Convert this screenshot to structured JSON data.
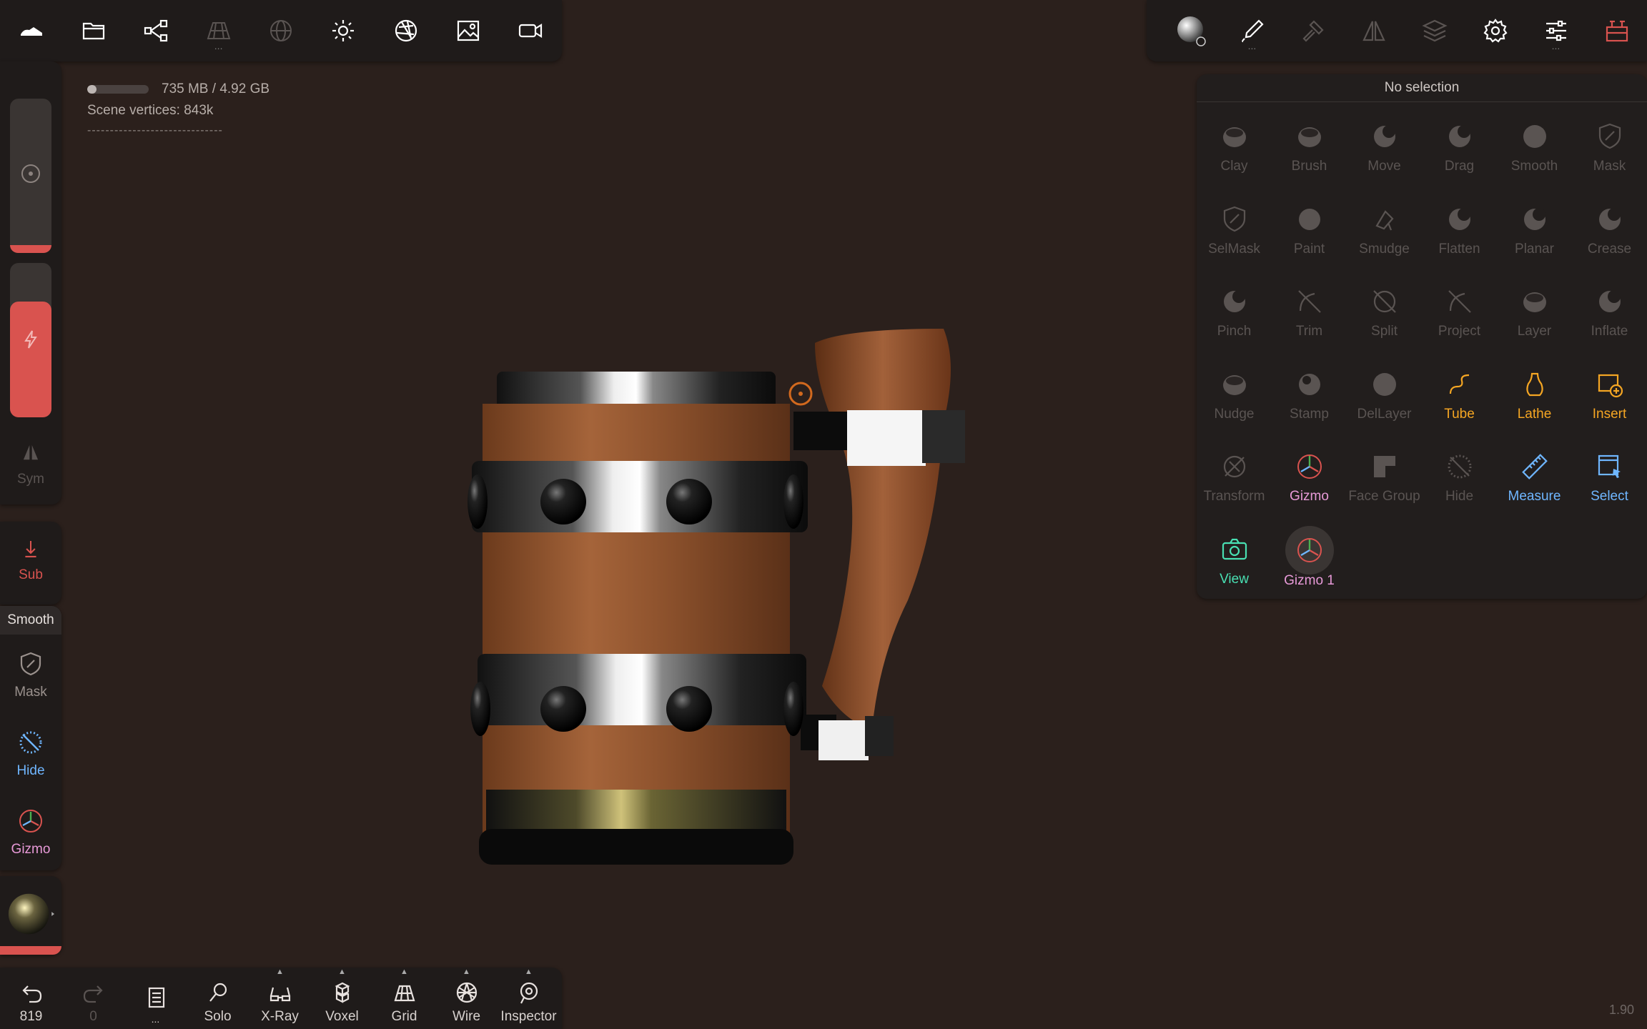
{
  "top_toolbar": {
    "left_icons": [
      "shoe-icon",
      "folder-icon",
      "scene-graph-icon",
      "topology-icon",
      "sphere-grid-icon",
      "light-icon",
      "aperture-icon",
      "image-icon",
      "video-camera-icon"
    ],
    "right_icons": [
      "material-sphere-icon",
      "brush-settings-icon",
      "hammer-icon",
      "symmetry-icon",
      "layers-icon",
      "gear-icon",
      "sliders-icon",
      "scene-tools-icon"
    ]
  },
  "stats": {
    "memory": "735 MB / 4.92 GB",
    "memory_used_fraction": 0.15,
    "scene_vertices_label": "Scene vertices:",
    "scene_vertices_value": "843k",
    "divider": "------------------------------"
  },
  "left_sidebar": {
    "sym_label": "Sym",
    "sub_label": "Sub",
    "smooth_label": "Smooth",
    "mask_label": "Mask",
    "hide_label": "Hide",
    "gizmo_label": "Gizmo",
    "radius_level": 0.05,
    "intensity_level": 0.75
  },
  "tools_panel": {
    "title": "No selection",
    "tools": [
      {
        "label": "Clay",
        "icon": "clay-icon",
        "active": false,
        "color": "#5a5452"
      },
      {
        "label": "Brush",
        "icon": "brush-icon",
        "active": false,
        "color": "#5a5452"
      },
      {
        "label": "Move",
        "icon": "move-icon",
        "active": false,
        "color": "#5a5452"
      },
      {
        "label": "Drag",
        "icon": "drag-icon",
        "active": false,
        "color": "#5a5452"
      },
      {
        "label": "Smooth",
        "icon": "smooth-icon",
        "active": false,
        "color": "#5a5452"
      },
      {
        "label": "Mask",
        "icon": "mask-icon",
        "active": false,
        "color": "#5a5452"
      },
      {
        "label": "SelMask",
        "icon": "selmask-icon",
        "active": false,
        "color": "#5a5452"
      },
      {
        "label": "Paint",
        "icon": "paint-icon",
        "active": false,
        "color": "#5a5452"
      },
      {
        "label": "Smudge",
        "icon": "smudge-icon",
        "active": false,
        "color": "#5a5452"
      },
      {
        "label": "Flatten",
        "icon": "flatten-icon",
        "active": false,
        "color": "#5a5452"
      },
      {
        "label": "Planar",
        "icon": "planar-icon",
        "active": false,
        "color": "#5a5452"
      },
      {
        "label": "Crease",
        "icon": "crease-icon",
        "active": false,
        "color": "#5a5452"
      },
      {
        "label": "Pinch",
        "icon": "pinch-icon",
        "active": false,
        "color": "#5a5452"
      },
      {
        "label": "Trim",
        "icon": "trim-icon",
        "active": false,
        "color": "#5a5452"
      },
      {
        "label": "Split",
        "icon": "split-icon",
        "active": false,
        "color": "#5a5452"
      },
      {
        "label": "Project",
        "icon": "project-icon",
        "active": false,
        "color": "#5a5452"
      },
      {
        "label": "Layer",
        "icon": "layer-icon",
        "active": false,
        "color": "#5a5452"
      },
      {
        "label": "Inflate",
        "icon": "inflate-icon",
        "active": false,
        "color": "#5a5452"
      },
      {
        "label": "Nudge",
        "icon": "nudge-icon",
        "active": false,
        "color": "#5a5452"
      },
      {
        "label": "Stamp",
        "icon": "stamp-icon",
        "active": false,
        "color": "#5a5452"
      },
      {
        "label": "DelLayer",
        "icon": "dellayer-icon",
        "active": false,
        "color": "#5a5452"
      },
      {
        "label": "Tube",
        "icon": "tube-icon",
        "active": true,
        "color": "#f5a623"
      },
      {
        "label": "Lathe",
        "icon": "lathe-icon",
        "active": true,
        "color": "#f5a623"
      },
      {
        "label": "Insert",
        "icon": "insert-icon",
        "active": true,
        "color": "#f5a623"
      },
      {
        "label": "Transform",
        "icon": "transform-icon",
        "active": false,
        "color": "#5a5452"
      },
      {
        "label": "Gizmo",
        "icon": "gizmo-icon",
        "active": true,
        "color": "#e89ad8"
      },
      {
        "label": "Face Group",
        "icon": "face-group-icon",
        "active": false,
        "color": "#5a5452"
      },
      {
        "label": "Hide",
        "icon": "hide-icon",
        "active": false,
        "color": "#5a5452"
      },
      {
        "label": "Measure",
        "icon": "ruler-icon",
        "active": true,
        "color": "#6fb6ff"
      },
      {
        "label": "Select",
        "icon": "select-icon",
        "active": true,
        "color": "#6fb6ff"
      },
      {
        "label": "View",
        "icon": "camera-icon",
        "active": true,
        "color": "#49e0b3"
      },
      {
        "label": "Gizmo 1",
        "icon": "gizmo-icon",
        "active": true,
        "color": "#e89ad8"
      }
    ]
  },
  "bottom_toolbar": {
    "items": [
      {
        "label": "819",
        "icon": "undo-icon",
        "caret": false
      },
      {
        "label": "0",
        "icon": "redo-icon",
        "caret": false
      },
      {
        "label": "...",
        "icon": "notebook-icon",
        "caret": false
      },
      {
        "label": "Solo",
        "icon": "search-icon",
        "caret": false
      },
      {
        "label": "X-Ray",
        "icon": "glasses-icon",
        "caret": true
      },
      {
        "label": "Voxel",
        "icon": "voxel-icon",
        "caret": true
      },
      {
        "label": "Grid",
        "icon": "grid-icon",
        "caret": true
      },
      {
        "label": "Wire",
        "icon": "wireframe-icon",
        "caret": true
      },
      {
        "label": "Inspector",
        "icon": "inspector-icon",
        "caret": true
      }
    ]
  },
  "version": "1.90",
  "colors": {
    "background": "#2b201c",
    "panel": "#1f1b1a",
    "orange": "#f5a623",
    "blue": "#6fb6ff",
    "pink": "#e89ad8",
    "teal": "#49e0b3",
    "red": "#d9534f"
  }
}
